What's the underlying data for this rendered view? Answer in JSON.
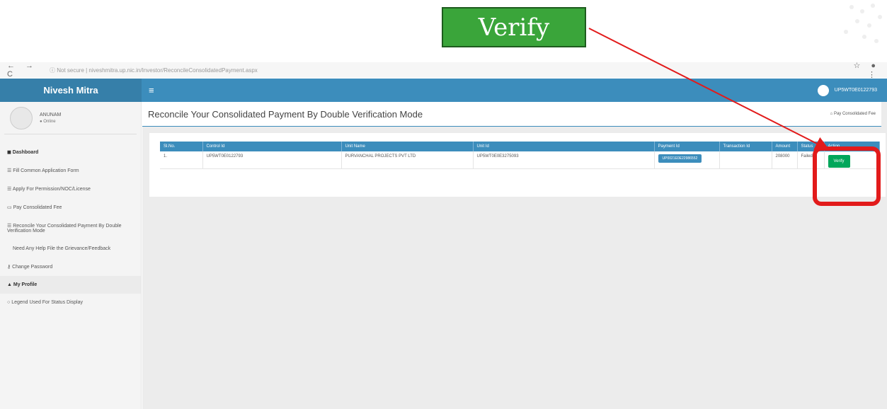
{
  "callout": {
    "label": "Verify"
  },
  "browser": {
    "nav": "← → C",
    "url": "ⓘ Not secure | niveshmitra.up.nic.in/Investor/ReconcileConsolidatedPayment.aspx",
    "ext": "☆ ● ⋮"
  },
  "topnav": {
    "brand": "Nivesh Mitra",
    "hamburger": "≡",
    "user_id": "UP5WT0E0122793"
  },
  "sidebar": {
    "username": "ANUNAM",
    "status": "● Online",
    "items": [
      {
        "label": "Dashboard"
      },
      {
        "label": "Fill Common Application Form"
      },
      {
        "label": "Apply For Permission/NOC/License"
      },
      {
        "label": "Pay Consolidated Fee"
      },
      {
        "label": "Reconcile Your Consolidated Payment By Double Verification Mode"
      },
      {
        "label": "Need Any Help File the Grievance/Feedback"
      },
      {
        "label": "Change Password"
      },
      {
        "label": "My Profile"
      },
      {
        "label": "Legend Used For Status Display"
      }
    ]
  },
  "main": {
    "title": "Reconcile Your Consolidated Payment By Double Verification Mode",
    "breadcrumb": "Pay Consolidated Fee"
  },
  "table": {
    "headers": [
      "Sl.No.",
      "Control Id",
      "Unit Name",
      "Unit Id",
      "Payment Id",
      "Transaction Id",
      "Amount",
      "Status",
      "Action"
    ],
    "row": {
      "sl": "1.",
      "control_id": "UP5WT0E0122793",
      "unit_name": "PURVANCHAL PROJECTS PVT LTD",
      "unit_id": "UP5WT0E0E3275093",
      "payment_id": "UP0021E0E22986552",
      "transaction_id": "",
      "amount": "208000",
      "status": "Failed",
      "action": "Verify"
    }
  },
  "colors": {
    "brand": "#3c8dbc",
    "brand_dark": "#367fa9",
    "verify": "#00a65a",
    "annotation": "#e21b1b",
    "callout": "#3aa53a"
  }
}
